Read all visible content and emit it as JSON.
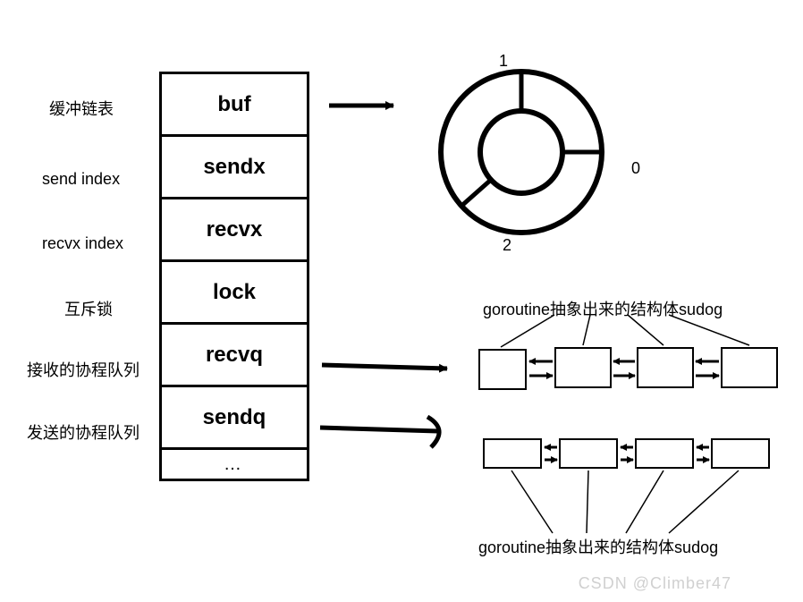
{
  "struct": {
    "fields": [
      "buf",
      "sendx",
      "recvx",
      "lock",
      "recvq",
      "sendq"
    ],
    "ellipsis": "…"
  },
  "labels": {
    "buf": "缓冲链表",
    "sendx": "send index",
    "recvx": "recvx index",
    "lock": "互斥锁",
    "recvq": "接收的协程队列",
    "sendq": "发送的协程队列"
  },
  "ring": {
    "slot_labels": [
      "0",
      "1",
      "2"
    ]
  },
  "captions": {
    "sudog_upper": "goroutine抽象出来的结构体sudog",
    "sudog_lower": "goroutine抽象出来的结构体sudog"
  },
  "queues": {
    "recvq": {
      "nodes": 4
    },
    "sendq": {
      "nodes": 4
    }
  },
  "watermark": "CSDN @Climber47",
  "colors": {
    "stroke": "#000000"
  }
}
